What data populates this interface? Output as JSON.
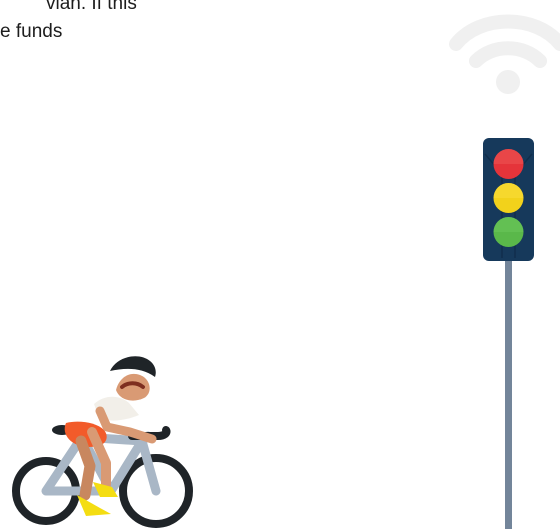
{
  "text": {
    "line_1": "vian. If this",
    "line_2": "e funds"
  },
  "icons": {
    "wifi": "wifi-icon",
    "traffic_light": "traffic-light-icon",
    "cyclist": "cyclist-icon"
  },
  "colors": {
    "text": "#1d1d1d",
    "wifi": "#f0f0f0",
    "traffic_light_body": "#16395b",
    "pole": "#73859a",
    "red_light": "#e5343a",
    "yellow_light": "#f2d21b",
    "green_light": "#5ab84a",
    "bike_frame": "#a9b7c6",
    "tire": "#1f2428",
    "shorts": "#f25b2a",
    "shoes": "#f4dd12"
  }
}
